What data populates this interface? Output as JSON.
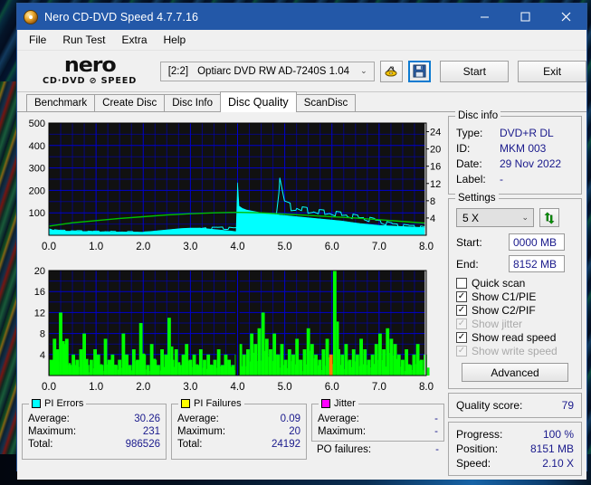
{
  "window": {
    "title": "Nero CD-DVD Speed 4.7.7.16",
    "icon": "nero-disc-icon",
    "minimize": "minimize-icon",
    "maximize": "maximize-icon",
    "close": "close-icon"
  },
  "menu": {
    "items": [
      "File",
      "Run Test",
      "Extra",
      "Help"
    ]
  },
  "logo": {
    "line1": "nero",
    "line2": "CD·DVD ⊘ SPEED"
  },
  "toolbar": {
    "drive_index": "[2:2]",
    "drive_name": "Optiarc DVD RW AD-7240S 1.04",
    "caret": "⌄",
    "eject_icon": "eject-disc-icon",
    "save_icon": "save-floppy-icon",
    "start_label": "Start",
    "exit_label": "Exit"
  },
  "tabs": [
    {
      "label": "Benchmark",
      "active": false
    },
    {
      "label": "Create Disc",
      "active": false
    },
    {
      "label": "Disc Info",
      "active": false
    },
    {
      "label": "Disc Quality",
      "active": true
    },
    {
      "label": "ScanDisc",
      "active": false
    }
  ],
  "disc_info": {
    "legend": "Disc info",
    "rows": [
      {
        "key": "Type:",
        "value": "DVD+R DL"
      },
      {
        "key": "ID:",
        "value": "MKM 003"
      },
      {
        "key": "Date:",
        "value": "29 Nov 2022"
      },
      {
        "key": "Label:",
        "value": "-"
      }
    ]
  },
  "settings": {
    "legend": "Settings",
    "speed_value": "5 X",
    "speed_caret": "⌄",
    "refresh_icon": "refresh-arrows-icon",
    "start_label": "Start:",
    "start_value": "0000 MB",
    "end_label": "End:",
    "end_value": "8152 MB",
    "checkboxes": [
      {
        "label": "Quick scan",
        "checked": false,
        "disabled": false
      },
      {
        "label": "Show C1/PIE",
        "checked": true,
        "disabled": false
      },
      {
        "label": "Show C2/PIF",
        "checked": true,
        "disabled": false
      },
      {
        "label": "Show jitter",
        "checked": true,
        "disabled": true
      },
      {
        "label": "Show read speed",
        "checked": true,
        "disabled": false
      },
      {
        "label": "Show write speed",
        "checked": true,
        "disabled": true
      }
    ],
    "advanced_label": "Advanced"
  },
  "quality": {
    "label": "Quality score:",
    "value": "79"
  },
  "status": {
    "rows": [
      {
        "key": "Progress:",
        "value": "100 %"
      },
      {
        "key": "Position:",
        "value": "8151 MB"
      },
      {
        "key": "Speed:",
        "value": "2.10 X"
      }
    ]
  },
  "stats": {
    "pi_errors": {
      "legend": "PI Errors",
      "color": "#00ffff",
      "rows": [
        {
          "key": "Average:",
          "value": "30.26"
        },
        {
          "key": "Maximum:",
          "value": "231"
        },
        {
          "key": "Total:",
          "value": "986526"
        }
      ]
    },
    "pi_failures": {
      "legend": "PI Failures",
      "color": "#ffff00",
      "rows": [
        {
          "key": "Average:",
          "value": "0.09"
        },
        {
          "key": "Maximum:",
          "value": "20"
        },
        {
          "key": "Total:",
          "value": "24192"
        }
      ]
    },
    "jitter": {
      "legend": "Jitter",
      "color": "#ff00ff",
      "rows": [
        {
          "key": "Average:",
          "value": "-"
        },
        {
          "key": "Maximum:",
          "value": "-"
        }
      ],
      "po_key": "PO failures:",
      "po_value": "-"
    }
  },
  "chart_data": [
    {
      "id": "pie-graph",
      "type": "area",
      "title": "PI Errors / read speed vs disc position",
      "xlabel": "",
      "ylabel": "PI Errors",
      "xlim": [
        0.0,
        8.0
      ],
      "xticks": [
        "0.0",
        "1.0",
        "2.0",
        "3.0",
        "4.0",
        "5.0",
        "6.0",
        "7.0",
        "8.0"
      ],
      "ylim": [
        0,
        500
      ],
      "yticks": [
        "100",
        "200",
        "300",
        "400",
        "500"
      ],
      "y2lim": [
        0,
        26
      ],
      "y2ticks": [
        "4",
        "8",
        "12",
        "16",
        "20",
        "24"
      ],
      "grid": true,
      "bg": "#111111",
      "gridcolor": "#0000d0",
      "series": [
        {
          "name": "PI Errors",
          "color": "#00ffff",
          "kind": "area",
          "x": [
            0.0,
            0.1,
            0.2,
            0.3,
            0.4,
            0.5,
            0.6,
            0.7,
            0.8,
            0.9,
            1.0,
            1.1,
            1.2,
            1.3,
            1.4,
            1.5,
            1.6,
            1.7,
            1.8,
            1.9,
            2.0,
            2.1,
            2.2,
            2.3,
            2.4,
            2.5,
            2.6,
            2.7,
            2.8,
            2.9,
            3.0,
            3.1,
            3.2,
            3.3,
            3.4,
            3.5,
            3.6,
            3.7,
            3.8,
            3.9,
            3.97,
            4.0,
            4.03,
            4.1,
            4.2,
            4.3,
            4.4,
            4.5,
            4.6,
            4.7,
            4.8,
            4.9,
            5.0,
            5.2,
            5.4,
            5.6,
            5.8,
            6.0,
            6.2,
            6.4,
            6.6,
            6.8,
            7.0,
            7.2,
            7.4,
            7.6,
            7.8,
            8.0
          ],
          "values": [
            30,
            22,
            20,
            19,
            18,
            18,
            17,
            17,
            16,
            16,
            15,
            15,
            14,
            14,
            14,
            14,
            13,
            13,
            13,
            13,
            14,
            16,
            18,
            20,
            22,
            24,
            26,
            28,
            30,
            31,
            32,
            32,
            31,
            30,
            28,
            26,
            24,
            22,
            20,
            18,
            16,
            235,
            130,
            120,
            112,
            108,
            104,
            100,
            97,
            95,
            93,
            90,
            88,
            84,
            80,
            76,
            72,
            68,
            64,
            58,
            52,
            48,
            44,
            42,
            40,
            38,
            36,
            34
          ]
        },
        {
          "name": "Read speed",
          "color": "#00c000",
          "kind": "line",
          "axis": "right",
          "x": [
            0.0,
            0.5,
            1.0,
            1.5,
            2.0,
            2.5,
            3.0,
            3.5,
            3.99,
            4.0,
            4.5,
            5.0,
            5.5,
            6.0,
            6.5,
            7.0,
            7.5,
            8.0
          ],
          "values": [
            2.1,
            2.9,
            3.4,
            3.9,
            4.3,
            4.7,
            5.0,
            5.2,
            5.3,
            5.3,
            5.2,
            4.9,
            4.6,
            4.3,
            4.0,
            3.6,
            3.2,
            2.8
          ]
        }
      ]
    },
    {
      "id": "pif-graph",
      "type": "bar",
      "title": "PI Failures vs disc position",
      "xlabel": "",
      "ylabel": "PI Failures",
      "xlim": [
        0.0,
        8.0
      ],
      "xticks": [
        "0.0",
        "1.0",
        "2.0",
        "3.0",
        "4.0",
        "5.0",
        "6.0",
        "7.0",
        "8.0"
      ],
      "ylim": [
        0,
        20
      ],
      "yticks": [
        "4",
        "8",
        "12",
        "16",
        "20"
      ],
      "grid": true,
      "bg": "#111111",
      "gridcolor": "#0000d0",
      "series": [
        {
          "name": "PI Failures",
          "color": "#00ff00",
          "spike_color": "#ff8000",
          "x": [
            0.05,
            0.12,
            0.18,
            0.25,
            0.32,
            0.38,
            0.45,
            0.52,
            0.6,
            0.68,
            0.75,
            0.82,
            0.9,
            0.98,
            1.05,
            1.12,
            1.2,
            1.28,
            1.35,
            1.42,
            1.5,
            1.58,
            1.65,
            1.72,
            1.8,
            1.88,
            1.95,
            2.02,
            2.1,
            2.18,
            2.25,
            2.32,
            2.4,
            2.48,
            2.55,
            2.62,
            2.7,
            2.78,
            2.85,
            2.92,
            3.0,
            3.08,
            3.15,
            3.22,
            3.3,
            3.38,
            3.45,
            3.52,
            3.6,
            3.68,
            3.75,
            3.82,
            3.9,
            3.98,
            4.06,
            4.14,
            4.22,
            4.3,
            4.38,
            4.46,
            4.54,
            4.62,
            4.7,
            4.78,
            4.86,
            4.94,
            5.02,
            5.1,
            5.18,
            5.26,
            5.34,
            5.42,
            5.5,
            5.58,
            5.66,
            5.74,
            5.82,
            5.9,
            5.98,
            6.06,
            6.14,
            6.22,
            6.3,
            6.38,
            6.46,
            6.54,
            6.62,
            6.7,
            6.78,
            6.86,
            6.94,
            7.02,
            7.1,
            7.18,
            7.26,
            7.34,
            7.42,
            7.5,
            7.58,
            7.66,
            7.74,
            7.82,
            7.9,
            7.98
          ],
          "values": [
            3,
            7,
            5,
            12,
            6,
            7,
            2,
            4,
            3,
            5,
            8,
            2,
            3,
            5,
            4,
            2,
            7,
            3,
            4,
            2,
            3,
            8,
            4,
            2,
            5,
            3,
            10,
            4,
            2,
            6,
            3,
            2,
            5,
            4,
            11,
            3,
            5,
            2,
            4,
            6,
            3,
            4,
            2,
            5,
            3,
            4,
            2,
            3,
            5,
            2,
            4,
            3,
            2,
            4,
            6,
            4,
            5,
            8,
            6,
            9,
            12,
            7,
            5,
            8,
            4,
            6,
            3,
            5,
            4,
            7,
            3,
            5,
            9,
            6,
            4,
            3,
            5,
            7,
            4,
            20,
            5,
            4,
            6,
            3,
            5,
            4,
            7,
            5,
            3,
            4,
            6,
            8,
            5,
            9,
            7,
            6,
            4,
            3,
            5,
            2,
            4,
            6,
            3,
            4
          ],
          "spike_x": 5.98
        }
      ]
    }
  ]
}
